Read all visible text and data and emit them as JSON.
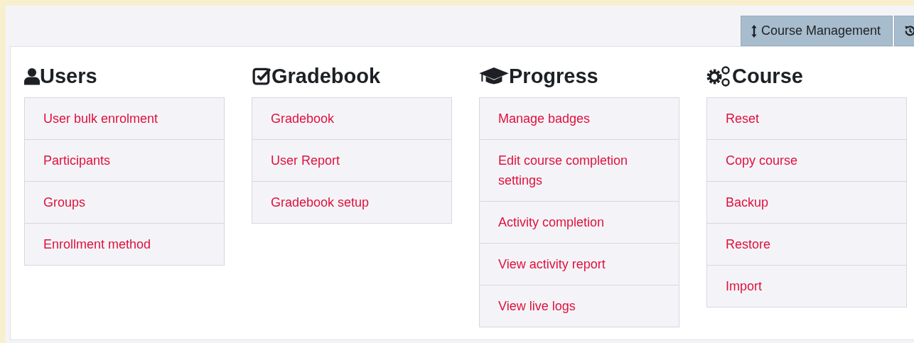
{
  "toolbar": {
    "buttons": [
      {
        "label": "Course Management"
      }
    ]
  },
  "sections": [
    {
      "title": "Users",
      "items": [
        "User bulk enrolment",
        "Participants",
        "Groups",
        "Enrollment method"
      ]
    },
    {
      "title": "Gradebook",
      "items": [
        "Gradebook",
        "User Report",
        "Gradebook setup"
      ]
    },
    {
      "title": "Progress",
      "items": [
        "Manage badges",
        "Edit course completion settings",
        "Activity completion",
        "View activity report",
        "View live logs"
      ]
    },
    {
      "title": "Course",
      "items": [
        "Reset",
        "Copy course",
        "Backup",
        "Restore",
        "Import"
      ]
    }
  ]
}
